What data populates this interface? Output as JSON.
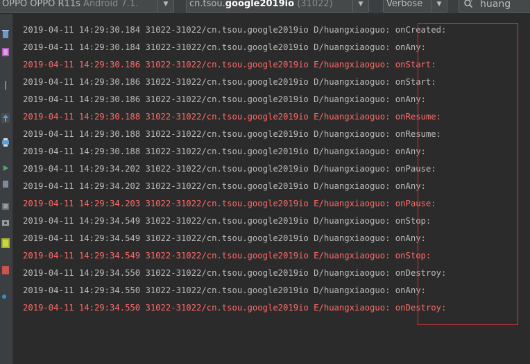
{
  "toolbar": {
    "device": {
      "model": "OPPO OPPO R11s",
      "api": "Android 7.1."
    },
    "process": {
      "pkg_prefix": "cn.tsou.",
      "pkg_highlight": "google2019io",
      "pid": "(31022)"
    },
    "log_level": "Verbose",
    "search": {
      "value": "huang"
    }
  },
  "sidebar_icons": [
    "trash-icon",
    "soft-wrap-icon",
    "scroll-icon",
    "up-icon",
    "print-icon",
    "restart-icon",
    "down-icon",
    "screenshot-icon",
    "camera-icon",
    "android-icon",
    "stop-icon",
    "help-icon"
  ],
  "colors": {
    "debug": "#bbbbbb",
    "error": "#ff6b68",
    "background": "#2b2b2b",
    "highlight_box": "#d8333a"
  },
  "log_lines": [
    {
      "level": "D",
      "text": "2019-04-11 14:29:30.184 31022-31022/cn.tsou.google2019io D/huangxiaoguo: onCreated:"
    },
    {
      "level": "D",
      "text": "2019-04-11 14:29:30.184 31022-31022/cn.tsou.google2019io D/huangxiaoguo: onAny:"
    },
    {
      "level": "E",
      "text": "2019-04-11 14:29:30.186 31022-31022/cn.tsou.google2019io E/huangxiaoguo: onStart:"
    },
    {
      "level": "D",
      "text": "2019-04-11 14:29:30.186 31022-31022/cn.tsou.google2019io D/huangxiaoguo: onStart:"
    },
    {
      "level": "D",
      "text": "2019-04-11 14:29:30.186 31022-31022/cn.tsou.google2019io D/huangxiaoguo: onAny:"
    },
    {
      "level": "E",
      "text": "2019-04-11 14:29:30.188 31022-31022/cn.tsou.google2019io E/huangxiaoguo: onResume:"
    },
    {
      "level": "D",
      "text": "2019-04-11 14:29:30.188 31022-31022/cn.tsou.google2019io D/huangxiaoguo: onResume:"
    },
    {
      "level": "D",
      "text": "2019-04-11 14:29:30.188 31022-31022/cn.tsou.google2019io D/huangxiaoguo: onAny:"
    },
    {
      "level": "D",
      "text": "2019-04-11 14:29:34.202 31022-31022/cn.tsou.google2019io D/huangxiaoguo: onPause:"
    },
    {
      "level": "D",
      "text": "2019-04-11 14:29:34.202 31022-31022/cn.tsou.google2019io D/huangxiaoguo: onAny:"
    },
    {
      "level": "E",
      "text": "2019-04-11 14:29:34.203 31022-31022/cn.tsou.google2019io E/huangxiaoguo: onPause:"
    },
    {
      "level": "D",
      "text": "2019-04-11 14:29:34.549 31022-31022/cn.tsou.google2019io D/huangxiaoguo: onStop:"
    },
    {
      "level": "D",
      "text": "2019-04-11 14:29:34.549 31022-31022/cn.tsou.google2019io D/huangxiaoguo: onAny:"
    },
    {
      "level": "E",
      "text": "2019-04-11 14:29:34.549 31022-31022/cn.tsou.google2019io E/huangxiaoguo: onStop:"
    },
    {
      "level": "D",
      "text": "2019-04-11 14:29:34.550 31022-31022/cn.tsou.google2019io D/huangxiaoguo: onDestroy:"
    },
    {
      "level": "D",
      "text": "2019-04-11 14:29:34.550 31022-31022/cn.tsou.google2019io D/huangxiaoguo: onAny:"
    },
    {
      "level": "E",
      "text": "2019-04-11 14:29:34.550 31022-31022/cn.tsou.google2019io E/huangxiaoguo: onDestroy:"
    }
  ]
}
